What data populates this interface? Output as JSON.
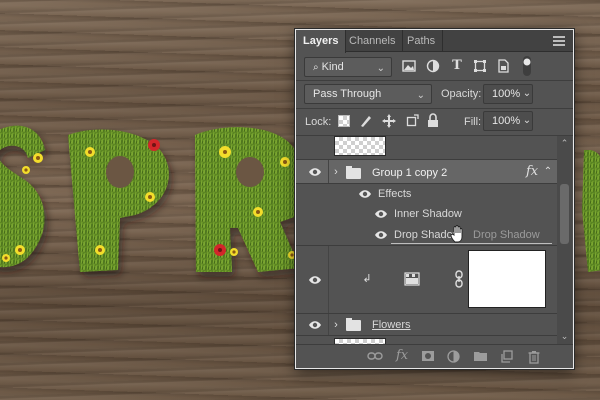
{
  "tabs": [
    {
      "label": "Layers"
    },
    {
      "label": "Channels"
    },
    {
      "label": "Paths"
    }
  ],
  "filter": {
    "value": "Kind"
  },
  "blend": {
    "value": "Pass Through"
  },
  "opacity": {
    "label": "Opacity:",
    "value": "100%"
  },
  "lock": {
    "label": "Lock:"
  },
  "fill": {
    "label": "Fill:",
    "value": "100%"
  },
  "layers": {
    "group_name": "Group 1 copy 2",
    "fx_label": "fx",
    "effects_label": "Effects",
    "inner_shadow": "Inner Shadow",
    "drop_shadow": "Drop Shadow",
    "drop_shadow_ghost": "Drop Shadow",
    "flowers_name": "Flowers"
  },
  "colors": {
    "panel_bg": "#535353",
    "tab_bg": "#424242",
    "accent_flower_yellow": "#f3dd2b",
    "accent_flower_red": "#d2262a",
    "grass": "#5d8a24"
  }
}
